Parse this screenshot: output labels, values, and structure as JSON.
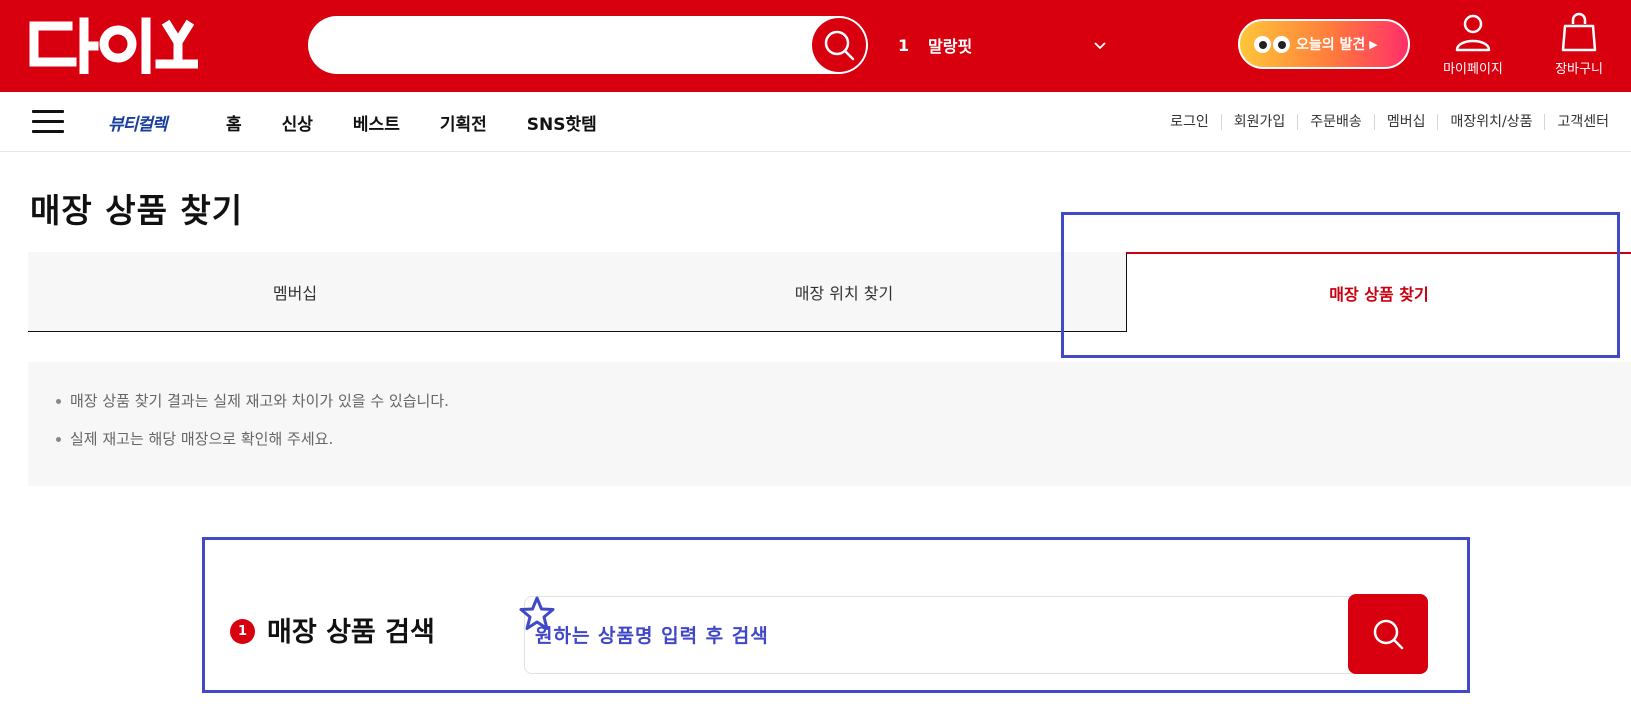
{
  "header": {
    "logo_text": "다이소",
    "search_placeholder": "",
    "rank": {
      "number": "1",
      "keyword": "말랑핏"
    },
    "discover_label": "오늘의 발견",
    "mypage_label": "마이페이지",
    "cart_label": "장바구니",
    "brand_color": "#d8000f"
  },
  "nav": {
    "brand": "뷰티컬렉",
    "main_items": [
      "홈",
      "신상",
      "베스트",
      "기획전",
      "SNS핫템"
    ],
    "util_items": [
      "로그인",
      "회원가입",
      "주문배송",
      "멤버십",
      "매장위치/상품",
      "고객센터"
    ]
  },
  "page": {
    "title": "매장 상품 찾기",
    "tabs": [
      {
        "label": "멤버십",
        "active": false
      },
      {
        "label": "매장 위치 찾기",
        "active": false
      },
      {
        "label": "매장 상품 찾기",
        "active": true
      }
    ],
    "notices": [
      "매장 상품 찾기 결과는 실제 재고와 차이가 있을 수 있습니다.",
      "실제 재고는 해당 매장으로 확인해 주세요."
    ]
  },
  "product_search": {
    "step": "1",
    "label": "매장 상품 검색",
    "placeholder": "원하는 상품명 입력 후 검색"
  },
  "annotation_color": "#4149c7"
}
